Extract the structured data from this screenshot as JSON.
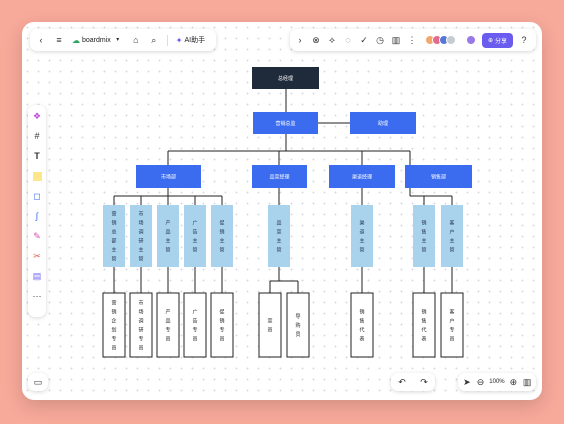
{
  "toolbar": {
    "brand": "boardmix",
    "ai_label": "AI助手",
    "share_label": "分享",
    "icons": [
      "back-icon",
      "menu-icon",
      "tag-icon",
      "search-icon",
      "expand-icon",
      "ai-icon",
      "magic-icon",
      "comment-icon",
      "timer-icon",
      "chart-icon",
      "more-icon",
      "help-icon"
    ]
  },
  "sidebar": {
    "tools": [
      "ai-tool-icon",
      "frame-icon",
      "text-icon",
      "sticky-note-icon",
      "shape-icon",
      "connector-icon",
      "pen-icon",
      "mindmap-icon",
      "template-icon",
      "more-icon"
    ]
  },
  "zoom": {
    "level": "100%"
  },
  "colors": {
    "accent": "#6b5cf0",
    "dark_node": "#1f2a3a",
    "blue_node": "#3b6cf0",
    "light_node": "#a9d3ec"
  },
  "org": {
    "root": "总经理",
    "level1": [
      "营销总监",
      "助理"
    ],
    "level2": [
      "市场部",
      "品宣经理",
      "渠道经理",
      "销售部"
    ],
    "level3": [
      "营销总部主管",
      "市场调研主管",
      "产品主管",
      "广告主管",
      "促销主管",
      "品宣主管",
      "渠道主管",
      "销售主管",
      "客户主管"
    ],
    "level4": [
      "营销企划专员",
      "市场调研专员",
      "产品专员",
      "广告专员",
      "促销专员",
      "宣员",
      "导购员",
      "销售代表",
      "销售代表",
      "客户专员"
    ]
  }
}
